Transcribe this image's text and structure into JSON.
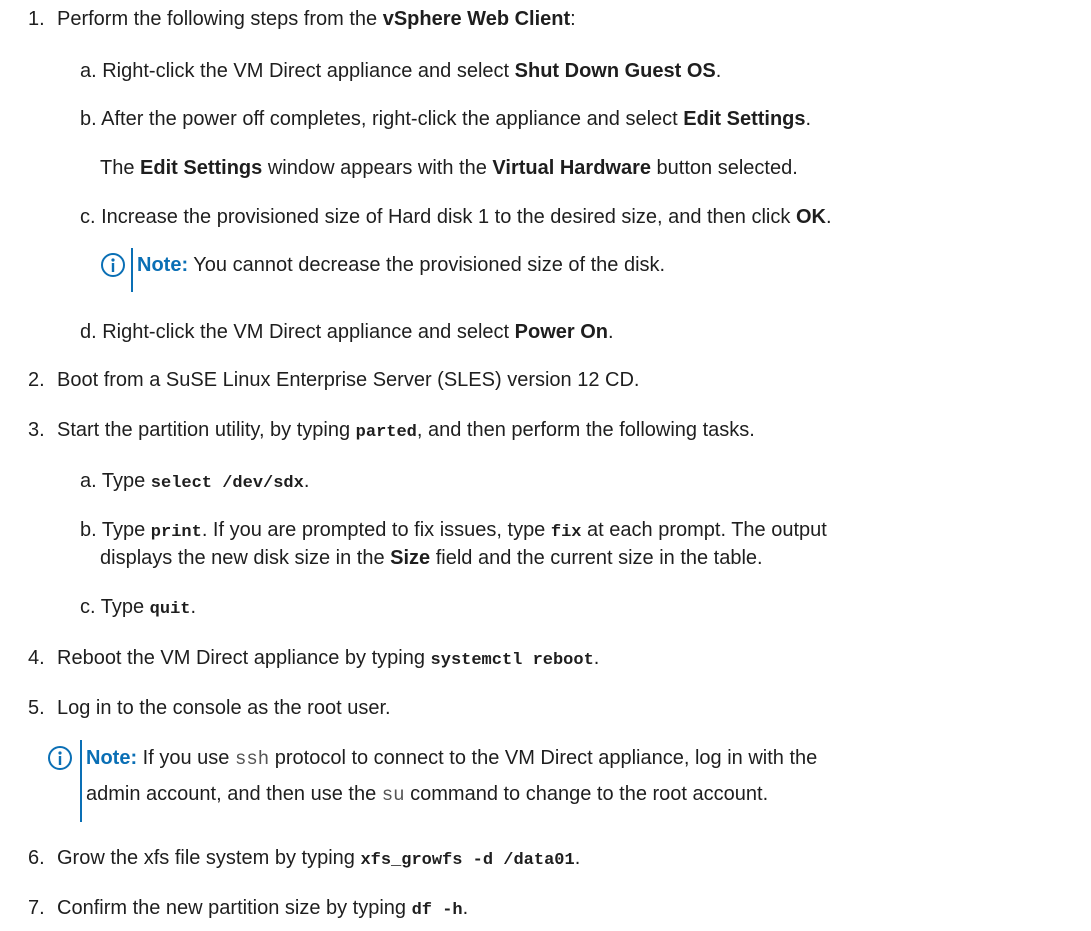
{
  "steps": [
    {
      "num": "1.",
      "parts": [
        "Perform the following steps from the ",
        "vSphere Web Client",
        ":"
      ]
    },
    {
      "num": "2.",
      "text": "Boot from a SuSE Linux Enterprise Server (SLES) version 12 CD."
    },
    {
      "num": "3.",
      "parts": [
        "Start the partition utility, by typing ",
        "parted",
        ", and then perform the following tasks."
      ]
    },
    {
      "num": "4.",
      "parts": [
        "Reboot the VM Direct appliance by typing ",
        "systemctl reboot",
        "."
      ]
    },
    {
      "num": "5.",
      "text": "Log in to the console as the root user."
    },
    {
      "num": "6.",
      "parts": [
        "Grow the xfs file system by typing ",
        "xfs_growfs -d /data01",
        "."
      ]
    },
    {
      "num": "7.",
      "parts": [
        "Confirm the new partition size by typing ",
        "df -h",
        "."
      ]
    }
  ],
  "step1_sub": {
    "a": [
      "a. Right-click the VM Direct appliance and select ",
      "Shut Down Guest OS",
      "."
    ],
    "b": [
      "b. After the power off completes, right-click the appliance and select ",
      "Edit Settings",
      "."
    ],
    "b_info": [
      "The ",
      "Edit Settings",
      " window appears with the ",
      "Virtual Hardware",
      " button selected."
    ],
    "c": [
      "c. Increase the provisioned size of Hard disk 1 to the desired size, and then click ",
      "OK",
      "."
    ],
    "c_note_label": "Note:",
    "c_note_text": " You cannot decrease the provisioned size of the disk.",
    "d": [
      "d. Right-click the VM Direct appliance and select ",
      "Power On",
      "."
    ]
  },
  "step3_sub": {
    "a": [
      "a. Type ",
      "select /dev/sdx",
      "."
    ],
    "b_line1": [
      "b. Type ",
      "print",
      ". If you are prompted to fix issues, type ",
      "fix",
      " at each prompt. The output"
    ],
    "b_line2": [
      "displays the new disk size in the ",
      "Size",
      " field and the current size in the table."
    ],
    "c": [
      "c. Type ",
      "quit",
      "."
    ]
  },
  "step5_note": {
    "label": "Note:",
    "line1": [
      " If you use ",
      "ssh",
      " protocol to connect to the VM Direct appliance, log in with the"
    ],
    "line2": [
      "admin account, and then use the ",
      "su",
      " command to change to the root account."
    ]
  }
}
